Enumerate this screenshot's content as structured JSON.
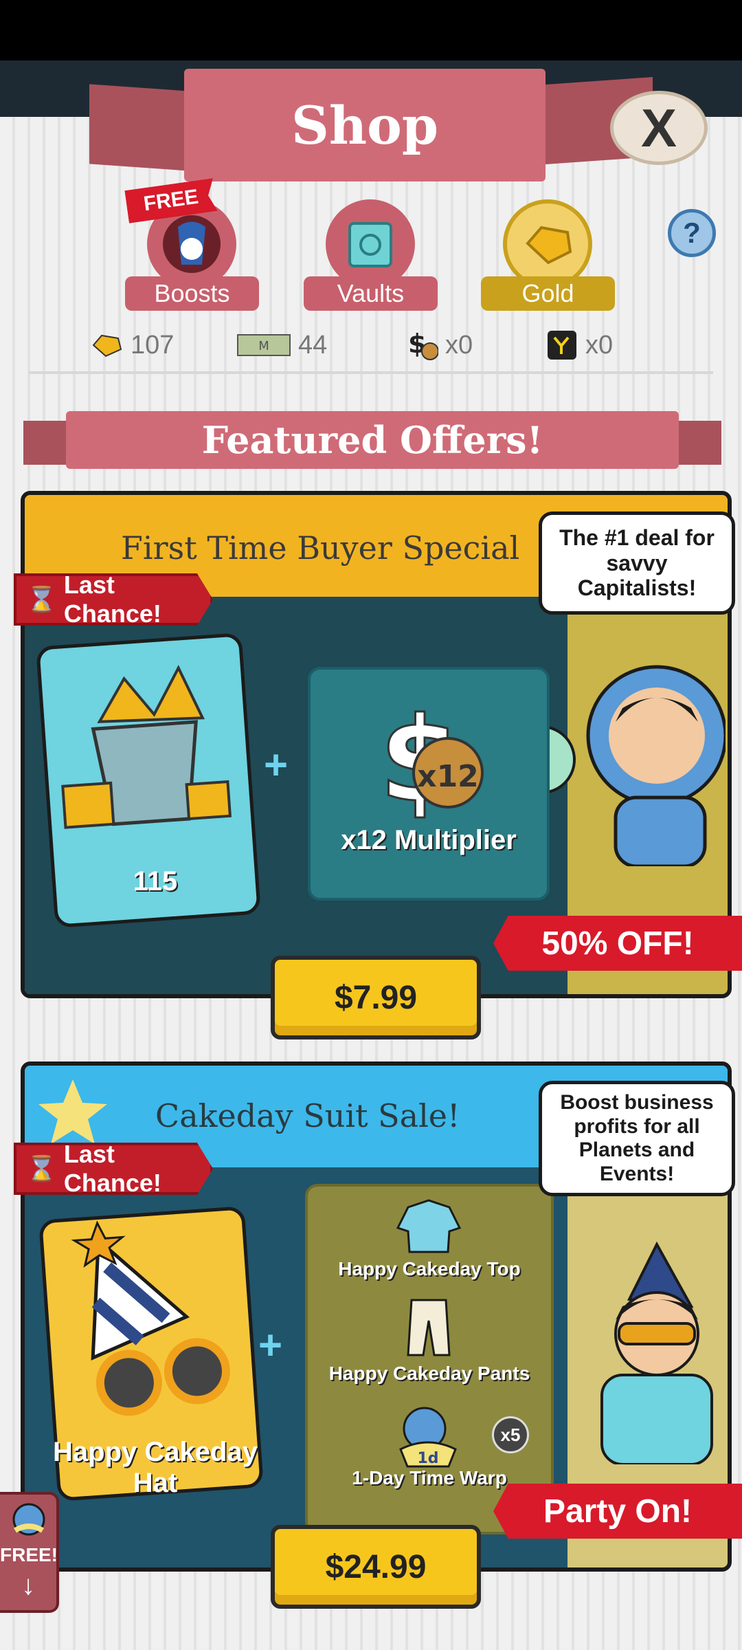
{
  "header": {
    "title": "Shop",
    "close_label": "X",
    "help_label": "?"
  },
  "categories": [
    {
      "label": "Boosts",
      "badge": "FREE",
      "color": "#c7606c",
      "icon": "boost-icon"
    },
    {
      "label": "Vaults",
      "color": "#c7606c",
      "icon": "vault-icon"
    },
    {
      "label": "Gold",
      "color": "#c9a11c",
      "icon": "gold-icon"
    }
  ],
  "currencies": [
    {
      "icon": "gold-gem-icon",
      "value": "107"
    },
    {
      "icon": "megabucks-icon",
      "value": "44"
    },
    {
      "icon": "money-bag-icon",
      "value": "x0"
    },
    {
      "icon": "timewarp-icon",
      "value": "x0"
    }
  ],
  "section": {
    "title": "Featured Offers!"
  },
  "offers": [
    {
      "title": "First Time Buyer Special",
      "badge": "Last Chance!",
      "bubble": "The #1 deal for savvy Capitalists!",
      "item1_caption": "115",
      "item2_caption": "x12 Multiplier",
      "item2_icon_text": "x12",
      "ribbon": "50% OFF!",
      "price": "$7.99"
    },
    {
      "title": "Cakeday Suit Sale!",
      "badge": "Last Chance!",
      "bubble": "Boost business profits for all Planets and Events!",
      "item1_caption": "Happy Cakeday Hat",
      "items": [
        {
          "label": "Happy Cakeday Top"
        },
        {
          "label": "Happy Cakeday Pants"
        },
        {
          "label": "1-Day Time Warp",
          "count": "x5",
          "icon_text": "1d"
        }
      ],
      "ribbon": "Party On!",
      "price": "$24.99"
    }
  ],
  "free_tab": {
    "label": "FREE!",
    "arrow": "↓"
  },
  "colors": {
    "card_head_1": "#f2b321",
    "card_head_2": "#3cb8ea",
    "panel_bg": "#f0f0f0",
    "banner": "#cf6b77"
  }
}
